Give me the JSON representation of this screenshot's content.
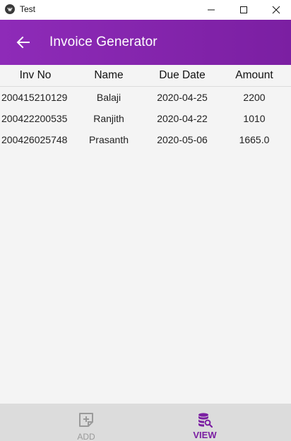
{
  "window": {
    "title": "Test"
  },
  "appbar": {
    "title": "Invoice Generator",
    "back_icon": "arrow-left-icon",
    "color": "#7b1fa2"
  },
  "table": {
    "headers": [
      "Inv No",
      "Name",
      "Due Date",
      "Amount"
    ],
    "rows": [
      [
        "200415210129",
        "Balaji",
        "2020-04-25",
        "2200"
      ],
      [
        "200422200535",
        "Ranjith",
        "2020-04-22",
        "1010"
      ],
      [
        "200426025748",
        "Prasanth",
        "2020-05-06",
        "1665.0"
      ]
    ]
  },
  "bottom_nav": {
    "items": [
      {
        "label": "ADD",
        "icon": "add-note-icon",
        "active": false
      },
      {
        "label": "VIEW",
        "icon": "database-search-icon",
        "active": true
      }
    ],
    "active_color": "#7b1fa2",
    "inactive_color": "#9a9a9a"
  }
}
